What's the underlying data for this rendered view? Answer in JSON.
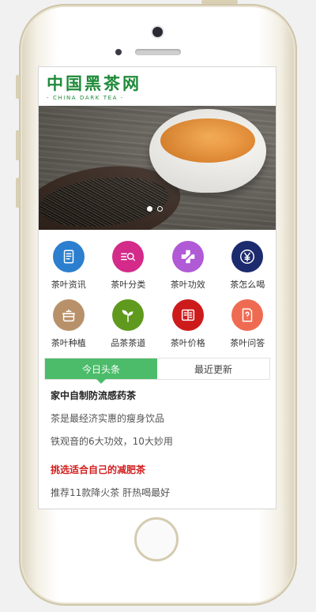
{
  "logo": {
    "title": "中国黑茶网",
    "subtitle": "- CHINA DARK TEA -"
  },
  "banner": {
    "slides": 2,
    "active_index": 0
  },
  "nav": [
    {
      "label": "茶叶资讯",
      "icon": "document-icon",
      "color": "#2b7fce"
    },
    {
      "label": "茶叶分类",
      "icon": "search-list-icon",
      "color": "#d42a8a"
    },
    {
      "label": "茶叶功效",
      "icon": "medical-cross-icon",
      "color": "#b05ad6"
    },
    {
      "label": "茶怎么喝",
      "icon": "yen-icon",
      "color": "#1c2a6e"
    },
    {
      "label": "茶叶种植",
      "icon": "pot-icon",
      "color": "#b8916a"
    },
    {
      "label": "品茶茶道",
      "icon": "sprout-icon",
      "color": "#5f9a1e"
    },
    {
      "label": "茶叶价格",
      "icon": "price-icon",
      "color": "#cd1b1b"
    },
    {
      "label": "茶叶问答",
      "icon": "question-doc-icon",
      "color": "#ee6b52"
    }
  ],
  "tabs": [
    {
      "label": "今日头条",
      "active": true
    },
    {
      "label": "最近更新",
      "active": false
    }
  ],
  "articles": [
    {
      "text": "家中自制防流感药茶",
      "style": "head"
    },
    {
      "text": "茶是最经济实惠的瘦身饮品",
      "style": "normal"
    },
    {
      "text": "铁观音的6大功效，10大妙用",
      "style": "normal"
    },
    {
      "text": "挑选适合自己的减肥茶",
      "style": "red"
    },
    {
      "text": "推荐11款降火茶 肝热喝最好",
      "style": "normal"
    }
  ]
}
